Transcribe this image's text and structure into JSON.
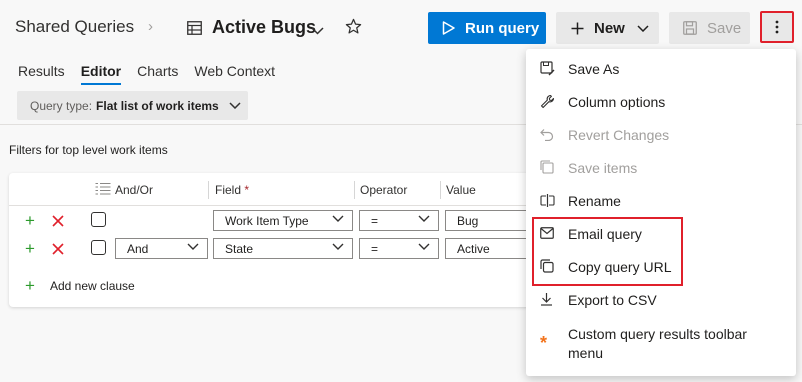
{
  "header": {
    "breadcrumb": "Shared Queries",
    "separator": "›",
    "title": "Active Bugs"
  },
  "toolbar": {
    "run_label": "Run query",
    "new_label": "New",
    "save_label": "Save",
    "more_icon": "more-vertical-icon"
  },
  "tabs": [
    {
      "label": "Results"
    },
    {
      "label": "Editor"
    },
    {
      "label": "Charts"
    },
    {
      "label": "Web Context"
    }
  ],
  "active_tab": "Editor",
  "query_type": {
    "prefix": "Query type:",
    "value": "Flat list of work items"
  },
  "filters_label": "Filters for top level work items",
  "columns": {
    "andor": "And/Or",
    "field": "Field",
    "required": "*",
    "operator": "Operator",
    "value": "Value"
  },
  "rows": [
    {
      "andor": "",
      "field": "Work Item Type",
      "operator": "=",
      "value": "Bug"
    },
    {
      "andor": "And",
      "field": "State",
      "operator": "=",
      "value": "Active"
    }
  ],
  "add_clause": "Add new clause",
  "menu": {
    "items": [
      {
        "label": "Save As",
        "icon": "save-as-icon",
        "disabled": false
      },
      {
        "label": "Column options",
        "icon": "wrench-icon",
        "disabled": false
      },
      {
        "label": "Revert Changes",
        "icon": "undo-icon",
        "disabled": true
      },
      {
        "label": "Save items",
        "icon": "save-items-icon",
        "disabled": true
      },
      {
        "label": "Rename",
        "icon": "rename-icon",
        "disabled": false
      },
      {
        "label": "Email query",
        "icon": "mail-icon",
        "disabled": false
      },
      {
        "label": "Copy query URL",
        "icon": "copy-icon",
        "disabled": false
      },
      {
        "label": "Export to CSV",
        "icon": "download-icon",
        "disabled": false
      },
      {
        "label": "Custom query results toolbar",
        "label_line2": "menu",
        "icon": "asterisk-icon",
        "disabled": false
      }
    ]
  },
  "colors": {
    "accent": "#0078d4",
    "highlight": "#e0202b",
    "add": "#2c9a2c",
    "remove": "#e0202b",
    "custom_icon": "#f2731c"
  }
}
